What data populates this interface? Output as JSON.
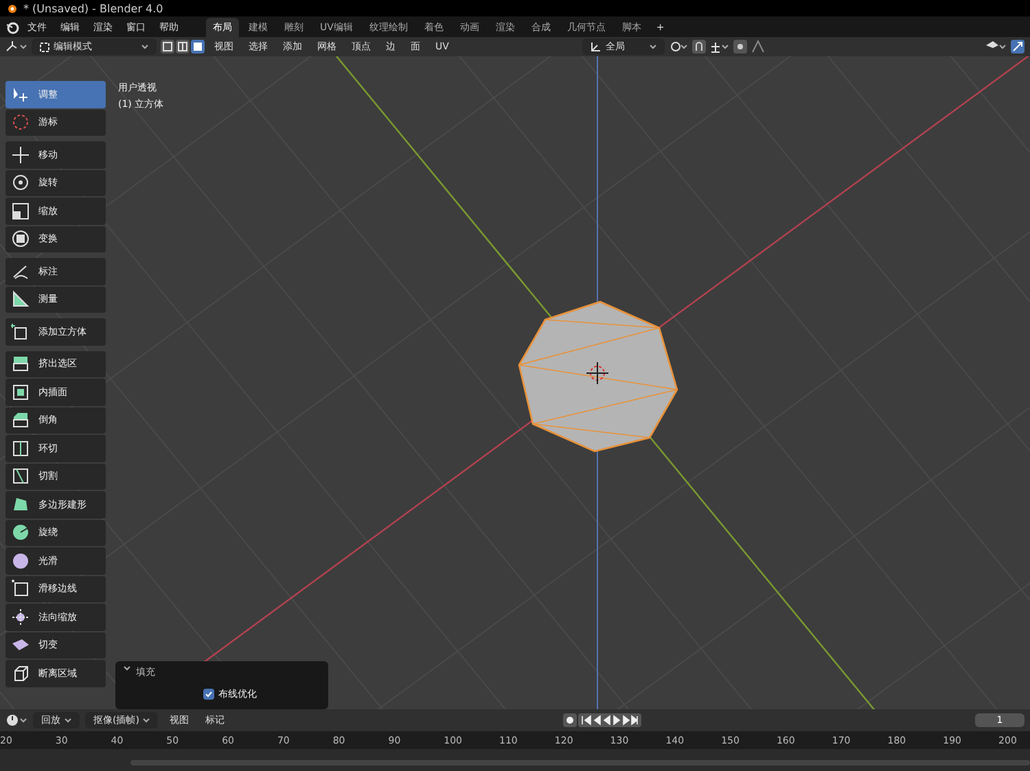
{
  "window": {
    "title": "* (Unsaved) - Blender 4.0"
  },
  "menu": [
    "文件",
    "编辑",
    "渲染",
    "窗口",
    "帮助"
  ],
  "workspaces": [
    {
      "label": "布局",
      "selected": true
    },
    {
      "label": "建模",
      "selected": false
    },
    {
      "label": "雕刻",
      "selected": false
    },
    {
      "label": "UV编辑",
      "selected": false
    },
    {
      "label": "纹理绘制",
      "selected": false
    },
    {
      "label": "着色",
      "selected": false
    },
    {
      "label": "动画",
      "selected": false
    },
    {
      "label": "渲染",
      "selected": false
    },
    {
      "label": "合成",
      "selected": false
    },
    {
      "label": "几何节点",
      "selected": false
    },
    {
      "label": "脚本",
      "selected": false
    }
  ],
  "add_workspace": "+",
  "header": {
    "mode": "编辑模式",
    "select_modes": [
      {
        "kind": "vertex",
        "selected": false
      },
      {
        "kind": "edge",
        "selected": false
      },
      {
        "kind": "face",
        "selected": true
      }
    ],
    "menus": [
      "视图",
      "选择",
      "添加",
      "网格",
      "顶点",
      "边",
      "面",
      "UV"
    ],
    "orientation": "全局"
  },
  "viewport": {
    "view_name": "用户透视",
    "object_name": "(1) 立方体"
  },
  "tools": [
    [
      {
        "label": "调整",
        "kind": "select",
        "selected": true
      },
      {
        "label": "游标",
        "kind": "cursor",
        "selected": false
      }
    ],
    [
      {
        "label": "移动",
        "kind": "move",
        "selected": false
      },
      {
        "label": "旋转",
        "kind": "rotate",
        "selected": false
      },
      {
        "label": "缩放",
        "kind": "scale",
        "selected": false
      },
      {
        "label": "变换",
        "kind": "transform",
        "selected": false
      }
    ],
    [
      {
        "label": "标注",
        "kind": "annotate",
        "selected": false
      },
      {
        "label": "测量",
        "kind": "measure",
        "selected": false
      }
    ],
    [
      {
        "label": "添加立方体",
        "kind": "cube",
        "selected": false
      }
    ],
    [
      {
        "label": "挤出选区",
        "kind": "extrude",
        "selected": false
      },
      {
        "label": "内插面",
        "kind": "inset",
        "selected": false
      },
      {
        "label": "倒角",
        "kind": "bevel",
        "selected": false
      },
      {
        "label": "环切",
        "kind": "loopcut",
        "selected": false
      },
      {
        "label": "切割",
        "kind": "knife",
        "selected": false
      },
      {
        "label": "多边形建形",
        "kind": "polybuild",
        "selected": false
      },
      {
        "label": "旋绕",
        "kind": "spin",
        "selected": false
      },
      {
        "label": "光滑",
        "kind": "smooth",
        "selected": false
      },
      {
        "label": "滑移边线",
        "kind": "slide",
        "selected": false
      },
      {
        "label": "法向缩放",
        "kind": "shrink",
        "selected": false
      },
      {
        "label": "切变",
        "kind": "shear",
        "selected": false
      },
      {
        "label": "断离区域",
        "kind": "rip",
        "selected": false
      }
    ]
  ],
  "operator_panel": {
    "title": "填充",
    "options": [
      {
        "label": "布线优化",
        "checked": true
      }
    ]
  },
  "timeline": {
    "menus": [
      "回放",
      "抠像(插帧)",
      "视图",
      "标记"
    ],
    "current_frame": "1",
    "ticks": [
      "20",
      "30",
      "40",
      "50",
      "60",
      "70",
      "80",
      "90",
      "100",
      "110",
      "120",
      "130",
      "140",
      "150",
      "160",
      "170",
      "180",
      "190",
      "200"
    ]
  }
}
